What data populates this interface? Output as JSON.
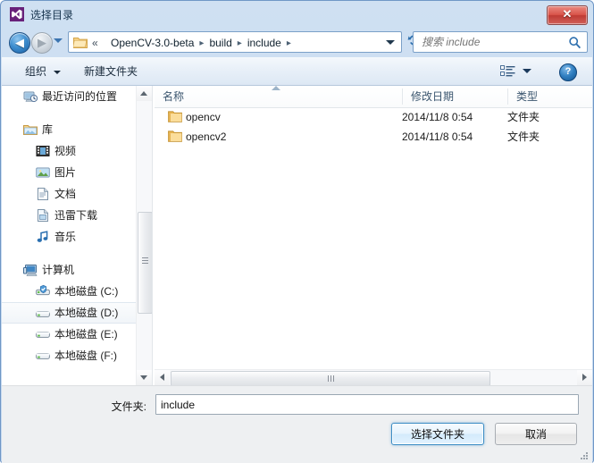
{
  "window": {
    "title": "选择目录",
    "icon": "visual-studio-icon",
    "close_label": "✕"
  },
  "navbar": {
    "back_glyph": "◀",
    "forward_glyph": "▶",
    "recent_dropdown": "recent-locations-caret",
    "address_chevrons": "«",
    "breadcrumbs": [
      {
        "label": "OpenCV-3.0-beta"
      },
      {
        "label": "build"
      },
      {
        "label": "include"
      }
    ],
    "crumb_separator": "▸",
    "refresh_glyph": "↻",
    "search": {
      "placeholder": "搜索 include",
      "value": ""
    }
  },
  "toolbar": {
    "organize_label": "组织",
    "new_folder_label": "新建文件夹",
    "view_button": "view-layout-icon",
    "help_label": "?"
  },
  "sidebar": {
    "items": [
      {
        "label": "最近访问的位置",
        "icon": "recent-places-icon",
        "level": 1,
        "selected": false
      },
      {
        "label": "",
        "icon": "",
        "level": 0,
        "gap": true
      },
      {
        "label": "库",
        "icon": "library-icon",
        "level": 1,
        "selected": false
      },
      {
        "label": "视频",
        "icon": "video-icon",
        "level": 2,
        "selected": false
      },
      {
        "label": "图片",
        "icon": "pictures-icon",
        "level": 2,
        "selected": false
      },
      {
        "label": "文档",
        "icon": "documents-icon",
        "level": 2,
        "selected": false
      },
      {
        "label": "迅雷下载",
        "icon": "downloads-icon",
        "level": 2,
        "selected": false
      },
      {
        "label": "音乐",
        "icon": "music-icon",
        "level": 2,
        "selected": false
      },
      {
        "label": "",
        "icon": "",
        "level": 0,
        "gap": true
      },
      {
        "label": "计算机",
        "icon": "computer-icon",
        "level": 1,
        "selected": false
      },
      {
        "label": "本地磁盘 (C:)",
        "icon": "system-drive-icon",
        "level": 2,
        "selected": false
      },
      {
        "label": "本地磁盘 (D:)",
        "icon": "drive-icon",
        "level": 2,
        "selected": true
      },
      {
        "label": "本地磁盘 (E:)",
        "icon": "drive-icon",
        "level": 2,
        "selected": false
      },
      {
        "label": "本地磁盘 (F:)",
        "icon": "drive-icon",
        "level": 2,
        "selected": false
      }
    ]
  },
  "filelist": {
    "columns": [
      {
        "label": "名称",
        "key": "name"
      },
      {
        "label": "修改日期",
        "key": "date"
      },
      {
        "label": "类型",
        "key": "type"
      }
    ],
    "sort_column": "名称",
    "sort_direction": "asc",
    "rows": [
      {
        "name": "opencv",
        "date": "2014/11/8 0:54",
        "type": "文件夹",
        "icon": "folder-icon"
      },
      {
        "name": "opencv2",
        "date": "2014/11/8 0:54",
        "type": "文件夹",
        "icon": "folder-icon"
      }
    ]
  },
  "footer": {
    "folder_label": "文件夹:",
    "folder_value": "include",
    "folder_placeholder": "",
    "select_button": "选择文件夹",
    "cancel_button": "取消"
  },
  "colors": {
    "accent": "#3c8dc5",
    "titlebar_text": "#16334d",
    "close_red": "#d9544a",
    "footer_bg": "#eef0f2",
    "frame_border": "#6f97c6"
  }
}
